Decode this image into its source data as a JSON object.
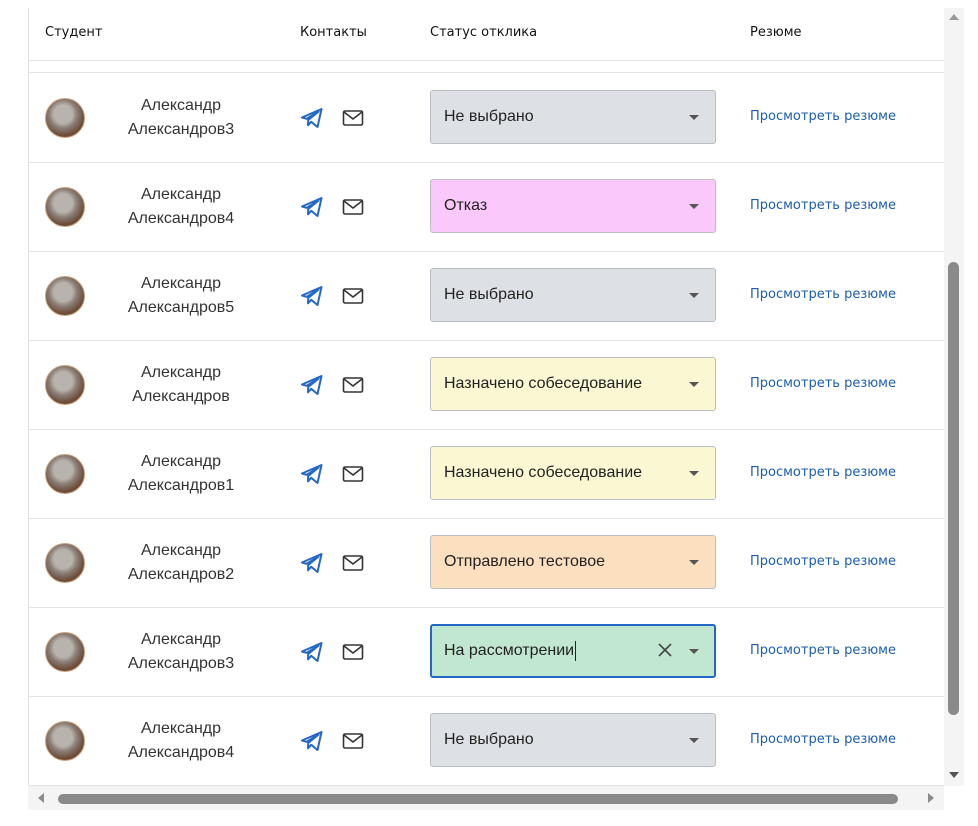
{
  "header": {
    "student": "Студент",
    "contacts": "Контакты",
    "status": "Статус отклика",
    "resume": "Резюме"
  },
  "colors": {
    "not_selected": "#dde1e5",
    "rejected": "#fbc8fc",
    "interview": "#fcf7d3",
    "test_sent": "#fbdfbf",
    "reviewing": "#c2e7d1",
    "link": "#1b5db3",
    "focus_border": "#2468c7"
  },
  "icons": {
    "contact_primary": "telegram-icon",
    "contact_secondary": "mail-icon",
    "select_caret": "chevron-down-icon",
    "select_clear": "close-icon"
  },
  "rows": [
    {
      "first_name": "Александр",
      "last_name": "Александров3",
      "status": "Не выбрано",
      "status_key": "not_selected",
      "resume_link": "Просмотреть резюме"
    },
    {
      "first_name": "Александр",
      "last_name": "Александров4",
      "status": "Отказ",
      "status_key": "rejected",
      "resume_link": "Просмотреть резюме"
    },
    {
      "first_name": "Александр",
      "last_name": "Александров5",
      "status": "Не выбрано",
      "status_key": "not_selected",
      "resume_link": "Просмотреть резюме"
    },
    {
      "first_name": "Александр",
      "last_name": "Александров",
      "status": "Назначено собеседование",
      "status_key": "interview",
      "resume_link": "Просмотреть резюме"
    },
    {
      "first_name": "Александр",
      "last_name": "Александров1",
      "status": "Назначено собеседование",
      "status_key": "interview",
      "resume_link": "Просмотреть резюме"
    },
    {
      "first_name": "Александр",
      "last_name": "Александров2",
      "status": "Отправлено тестовое",
      "status_key": "test_sent",
      "resume_link": "Просмотреть резюме"
    },
    {
      "first_name": "Александр",
      "last_name": "Александров3",
      "status": "На рассмотрении",
      "status_key": "reviewing",
      "resume_link": "Просмотреть резюме",
      "focused": true
    },
    {
      "first_name": "Александр",
      "last_name": "Александров4",
      "status": "Не выбрано",
      "status_key": "not_selected",
      "resume_link": "Просмотреть резюме"
    }
  ]
}
